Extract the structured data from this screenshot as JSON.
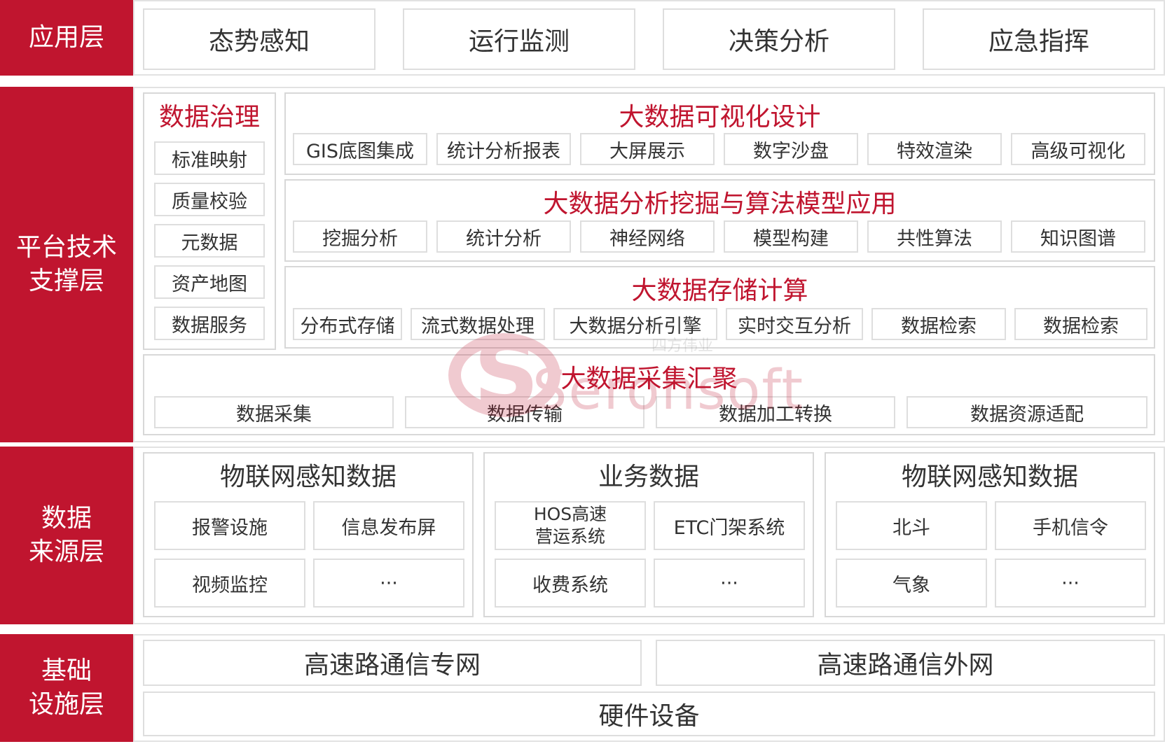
{
  "layers": {
    "application": {
      "label": "应用层",
      "items": [
        "态势感知",
        "运行监测",
        "决策分析",
        "应急指挥"
      ]
    },
    "platform": {
      "label": "平台技术\n支撑层",
      "governance": {
        "title": "数据治理",
        "items": [
          "标准映射",
          "质量校验",
          "元数据",
          "资产地图",
          "数据服务"
        ]
      },
      "visualization": {
        "title": "大数据可视化设计",
        "items": [
          "GIS底图集成",
          "统计分析报表",
          "大屏展示",
          "数字沙盘",
          "特效渲染",
          "高级可视化"
        ]
      },
      "mining": {
        "title": "大数据分析挖掘与算法模型应用",
        "items": [
          "挖掘分析",
          "统计分析",
          "神经网络",
          "模型构建",
          "共性算法",
          "知识图谱"
        ]
      },
      "storage": {
        "title": "大数据存储计算",
        "items": [
          "分布式存储",
          "流式数据处理",
          "大数据分析引擎",
          "实时交互分析",
          "数据检索",
          "数据检索"
        ]
      },
      "collection": {
        "title": "大数据采集汇聚",
        "items": [
          "数据采集",
          "数据传输",
          "数据加工转换",
          "数据资源适配"
        ]
      }
    },
    "source": {
      "label": "数据\n来源层",
      "groups": [
        {
          "title": "物联网感知数据",
          "items": [
            "报警设施",
            "信息发布屏",
            "视频监控",
            "···"
          ]
        },
        {
          "title": "业务数据",
          "items": [
            "HOS高速\n营运系统",
            "ETC门架系统",
            "收费系统",
            "···"
          ]
        },
        {
          "title": "物联网感知数据",
          "items": [
            "北斗",
            "手机信令",
            "气象",
            "···"
          ]
        }
      ]
    },
    "infrastructure": {
      "label": "基础\n设施层",
      "network_private": "高速路通信专网",
      "network_public": "高速路通信外网",
      "hardware": "硬件设备"
    }
  },
  "watermark": {
    "brand": "Seronsoft",
    "mark": "S",
    "cn": "四方伟业"
  },
  "colors": {
    "accent": "#c0152f",
    "border": "#dedede",
    "text": "#333333"
  }
}
